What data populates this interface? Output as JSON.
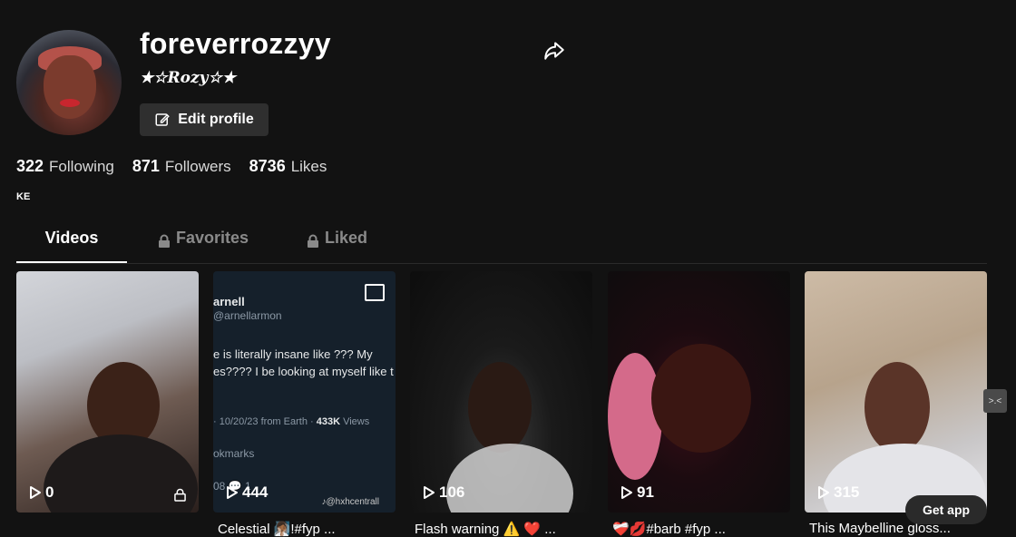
{
  "profile": {
    "username": "foreverrozzyy",
    "nickname": "★☆Rozy☆★",
    "edit_label": "Edit profile",
    "bio": "KE"
  },
  "stats": {
    "following": {
      "count": "322",
      "label": "Following"
    },
    "followers": {
      "count": "871",
      "label": "Followers"
    },
    "likes": {
      "count": "8736",
      "label": "Likes"
    }
  },
  "tabs": [
    {
      "label": "Videos",
      "active": true
    },
    {
      "label": "Favorites",
      "locked": true
    },
    {
      "label": "Liked",
      "locked": true
    }
  ],
  "videos": [
    {
      "views": "0",
      "caption": "",
      "private": true
    },
    {
      "views": "444",
      "caption": "Celestial 🧖🏾‍♀️!#fyp ..."
    },
    {
      "views": "106",
      "caption": "Flash warning ⚠️ ❤️ ..."
    },
    {
      "views": "91",
      "caption": "❤️‍🩹💋#barb #fyp ..."
    },
    {
      "views": "315",
      "caption": "This Maybelline gloss..."
    }
  ],
  "tweet": {
    "name": "arnell",
    "handle": "@arnellarmon",
    "line1": "e is literally insane like ??? My",
    "line2": "es???? I be looking at myself like t",
    "meta_prefix": "· 10/20/23 from Earth · ",
    "meta_views": "433K",
    "meta_suffix": " Views",
    "bookmarks": "okmarks",
    "counts": "08  💬 1",
    "watermark": "@hxhcentrall"
  },
  "get_app": "Get app",
  "side_tab": ">.<"
}
